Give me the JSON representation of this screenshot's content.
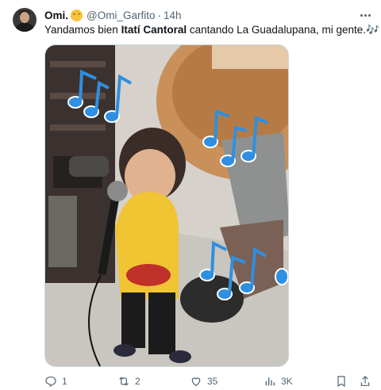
{
  "author": {
    "name": "Omi.",
    "handle": "@Omi_Garfito",
    "separator": "·",
    "time": "14h"
  },
  "post": {
    "text_before": "Yandamos bien ",
    "text_bold": "Itatí Cantoral",
    "text_after": " cantando La Guadalupana, mi gente.",
    "notes_emoji": "🎶"
  },
  "stats": {
    "replies": "1",
    "reposts": "2",
    "likes": "35",
    "views": "3K"
  },
  "icons": [
    "more-options-icon",
    "reply-icon",
    "repost-icon",
    "like-icon",
    "views-icon",
    "bookmark-icon",
    "share-icon"
  ],
  "colors": {
    "accent": "#3a9be6",
    "muted": "#536471",
    "text": "#0f1419"
  }
}
